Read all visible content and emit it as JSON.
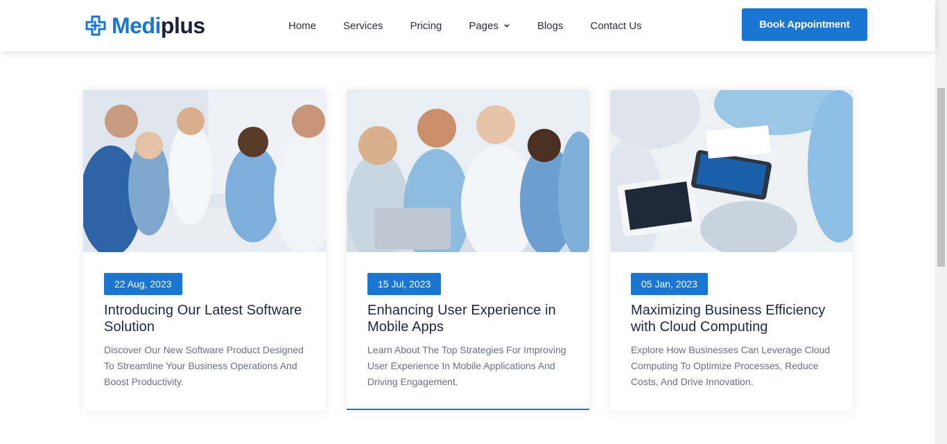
{
  "brand": {
    "part1": "Medi",
    "part2": "plus",
    "primary_color": "#1a76d1",
    "dark_color": "#1b2036"
  },
  "nav": {
    "items": [
      {
        "label": "Home"
      },
      {
        "label": "Services"
      },
      {
        "label": "Pricing"
      },
      {
        "label": "Pages",
        "has_dropdown": true
      },
      {
        "label": "Blogs"
      },
      {
        "label": "Contact Us"
      }
    ]
  },
  "cta": {
    "label": "Book Appointment"
  },
  "posts": [
    {
      "date": "22 Aug, 2023",
      "title": "Introducing Our Latest Software Solution",
      "excerpt": "Discover Our New Software Product Designed To Streamline Your Business Operations And Boost Productivity."
    },
    {
      "date": "15 Jul, 2023",
      "title": "Enhancing User Experience in Mobile Apps",
      "excerpt": "Learn About The Top Strategies For Improving User Experience In Mobile Applications And Driving Engagement."
    },
    {
      "date": "05 Jan, 2023",
      "title": "Maximizing Business Efficiency with Cloud Computing",
      "excerpt": "Explore How Businesses Can Leverage Cloud Computing To Optimize Processes, Reduce Costs, And Drive Innovation."
    }
  ]
}
